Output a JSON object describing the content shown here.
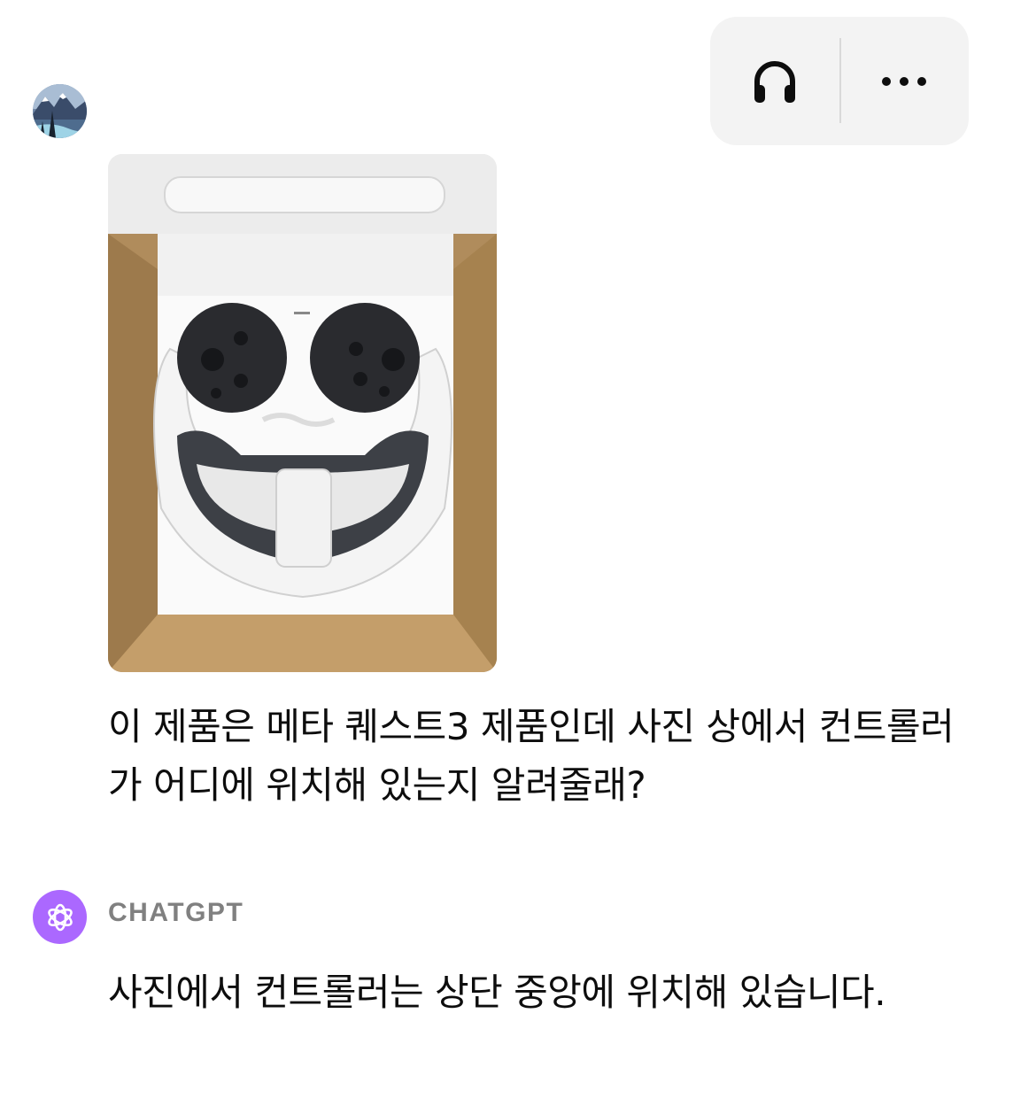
{
  "header": {
    "icons": [
      "headphones-icon",
      "more-options-icon"
    ]
  },
  "user": {
    "avatar_icon": "mountain-landscape-avatar",
    "photo_description_icon": "vr-headset-box-photo",
    "message": "이 제품은 메타 퀘스트3 제품인데 사진 상에서 컨트롤러가 어디에 위치해 있는지 알려줄래?"
  },
  "assistant": {
    "name": "CHATGPT",
    "logo_icon": "openai-logo-icon",
    "accent_color": "#ab68ff",
    "message": "사진에서 컨트롤러는 상단 중앙에 위치해 있습니다."
  }
}
